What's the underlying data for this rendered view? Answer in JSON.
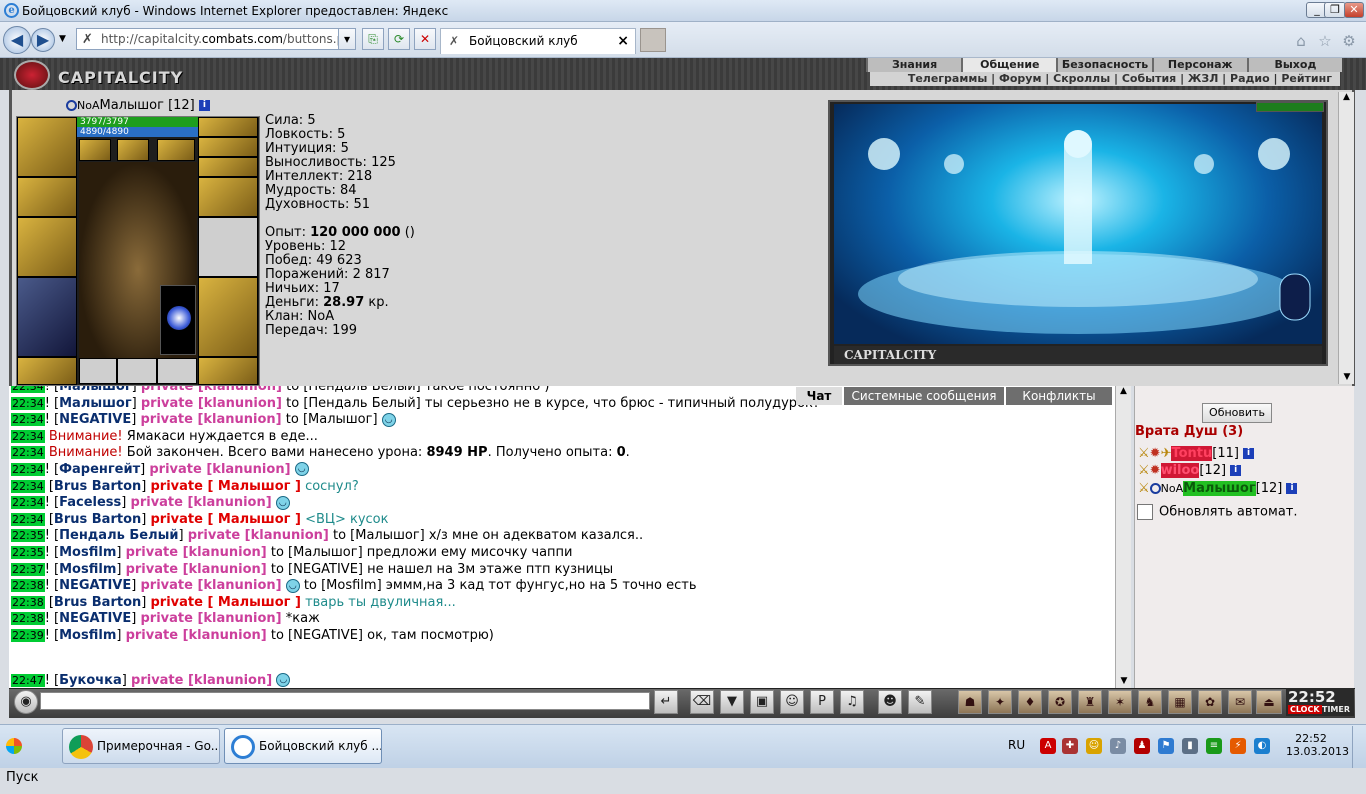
{
  "window": {
    "title": "Бойцовский клуб - Windows Internet Explorer предоставлен: Яндекс"
  },
  "browser": {
    "url_prefix": "http://capitalcity.",
    "url_domain": "combats.com",
    "url_rest": "/buttons.p",
    "tab_title": "Бойцовский клуб"
  },
  "game": {
    "logo": "CAPITALCITY",
    "menu_top": [
      "Знания",
      "Общение",
      "Безопасность",
      "Персонаж",
      "Выход"
    ],
    "menu_top_active": "Общение",
    "menu_sub": "Телеграммы | Форум | Скроллы | События | ЖЗЛ | Радио | Рейтинг",
    "character": {
      "clan_prefix": "NoA",
      "name": "Малышог",
      "level": "[12]",
      "hp": "3797/3797",
      "mp": "4890/4890"
    },
    "stats": [
      {
        "label": "Сила:",
        "value": "5"
      },
      {
        "label": "Ловкость:",
        "value": "5"
      },
      {
        "label": "Интуиция:",
        "value": "5"
      },
      {
        "label": "Выносливость:",
        "value": "125"
      },
      {
        "label": "Интеллект:",
        "value": "218"
      },
      {
        "label": "Мудрость:",
        "value": "84"
      },
      {
        "label": "Духовность:",
        "value": "51"
      }
    ],
    "info": {
      "exp_label": "Опыт:",
      "exp_value": "120 000 000",
      "exp_suffix": "()",
      "level": "Уровень: 12",
      "wins": "Побед: 49 623",
      "losses": "Поражений: 2 817",
      "draws": "Ничьих: 17",
      "money_label": "Деньги:",
      "money_value": "28.97",
      "money_suffix": "кр.",
      "clan": "Клан: NoA",
      "transfers": "Передач: 199"
    },
    "location_caption": "CAPITALCITY"
  },
  "chat": {
    "tabs": [
      "Чат",
      "Системные сообщения",
      "Конфликты"
    ],
    "lines": [
      {
        "time": "22:34",
        "nick": "Малышог",
        "tag": "private [klanunion]",
        "text": "to [Пендаль Белый] такое постоянно )",
        "kind": "priv"
      },
      {
        "time": "22:34",
        "nick": "Малышог",
        "tag": "private [klanunion]",
        "text": "to [Пендаль Белый] ты серьезно не в курсе, что брюс - типичный полудурок?",
        "kind": "priv"
      },
      {
        "time": "22:34",
        "nick": "NEGATIVE",
        "tag": "private [klanunion]",
        "text": "to [Малышог]",
        "kind": "priv",
        "smile": true
      },
      {
        "time": "22:34",
        "warn": "Внимание!",
        "text": "Ямакаси нуждается в еде...",
        "kind": "warn"
      },
      {
        "time": "22:34",
        "warn": "Внимание!",
        "text": "Бой закончен. Всего вами нанесено урона:",
        "bold1": "8949 HP",
        "text2": ". Получено опыта:",
        "bold2": "0",
        "text3": ".",
        "kind": "battle"
      },
      {
        "time": "22:34",
        "nick": "Фаренгейт",
        "tag": "private [klanunion]",
        "text": "",
        "kind": "priv",
        "smile": true
      },
      {
        "time": "22:34",
        "nick": "Brus Barton",
        "tag": "private [ Малышог ]",
        "text": "соснул?",
        "kind": "me"
      },
      {
        "time": "22:34",
        "nick": "Faceless",
        "tag": "private [klanunion]",
        "text": "",
        "kind": "priv",
        "smile": true
      },
      {
        "time": "22:34",
        "nick": "Brus Barton",
        "tag": "private [ Малышог ]",
        "text": "<ВЦ> кусок",
        "kind": "me"
      },
      {
        "time": "22:35",
        "nick": "Пендаль Белый",
        "tag": "private [klanunion]",
        "text": "to [Малышог] х/з мне он адекватом казался..",
        "kind": "priv"
      },
      {
        "time": "22:35",
        "nick": "Mosfilm",
        "tag": "private [klanunion]",
        "text": "to [Малышог] предложи ему мисочку чаппи",
        "kind": "priv"
      },
      {
        "time": "22:37",
        "nick": "Mosfilm",
        "tag": "private [klanunion]",
        "text": "to [NEGATIVE] не нашел на 3м этаже птп кузницы",
        "kind": "priv"
      },
      {
        "time": "22:38",
        "nick": "NEGATIVE",
        "tag": "private [klanunion]",
        "text": "to [Mosfilm] эммм,на 3 кад тот фунгус,но на 5 точно есть",
        "kind": "priv",
        "smile_before": true
      },
      {
        "time": "22:38",
        "nick": "Brus Barton",
        "tag": "private [ Малышог ]",
        "text": "тварь ты двуличная...",
        "kind": "me"
      },
      {
        "time": "22:38",
        "nick": "NEGATIVE",
        "tag": "private [klanunion]",
        "text": "*каж",
        "kind": "priv"
      },
      {
        "time": "22:39",
        "nick": "Mosfilm",
        "tag": "private [klanunion]",
        "text": "to [NEGATIVE] ок, там посмотрю)",
        "kind": "priv"
      },
      {
        "time": "",
        "kind": "blank"
      },
      {
        "time": "22:47",
        "nick": "Букочка",
        "tag": "private [klanunion]",
        "text": "",
        "kind": "priv",
        "smile": true
      }
    ]
  },
  "sidebar": {
    "refresh_label": "Обновить",
    "room": "Врата Душ (3)",
    "players": [
      {
        "name": "Tontu",
        "level": "[11]"
      },
      {
        "name": "wiloo",
        "level": "[12]"
      },
      {
        "clan": "NoA",
        "name": "Малышог",
        "level": "[12]"
      }
    ],
    "auto_refresh_label": "Обновлять автомат."
  },
  "toolbar": {
    "clock": "22:52",
    "clock_sub1": "CLOCK",
    "clock_sub2": "TIMER"
  },
  "taskbar": {
    "start": "Пуск",
    "tasks": [
      "Примерочная - Go...",
      "Бойцовский клуб ..."
    ],
    "lang": "RU",
    "time": "22:52",
    "date": "13.03.2013"
  }
}
